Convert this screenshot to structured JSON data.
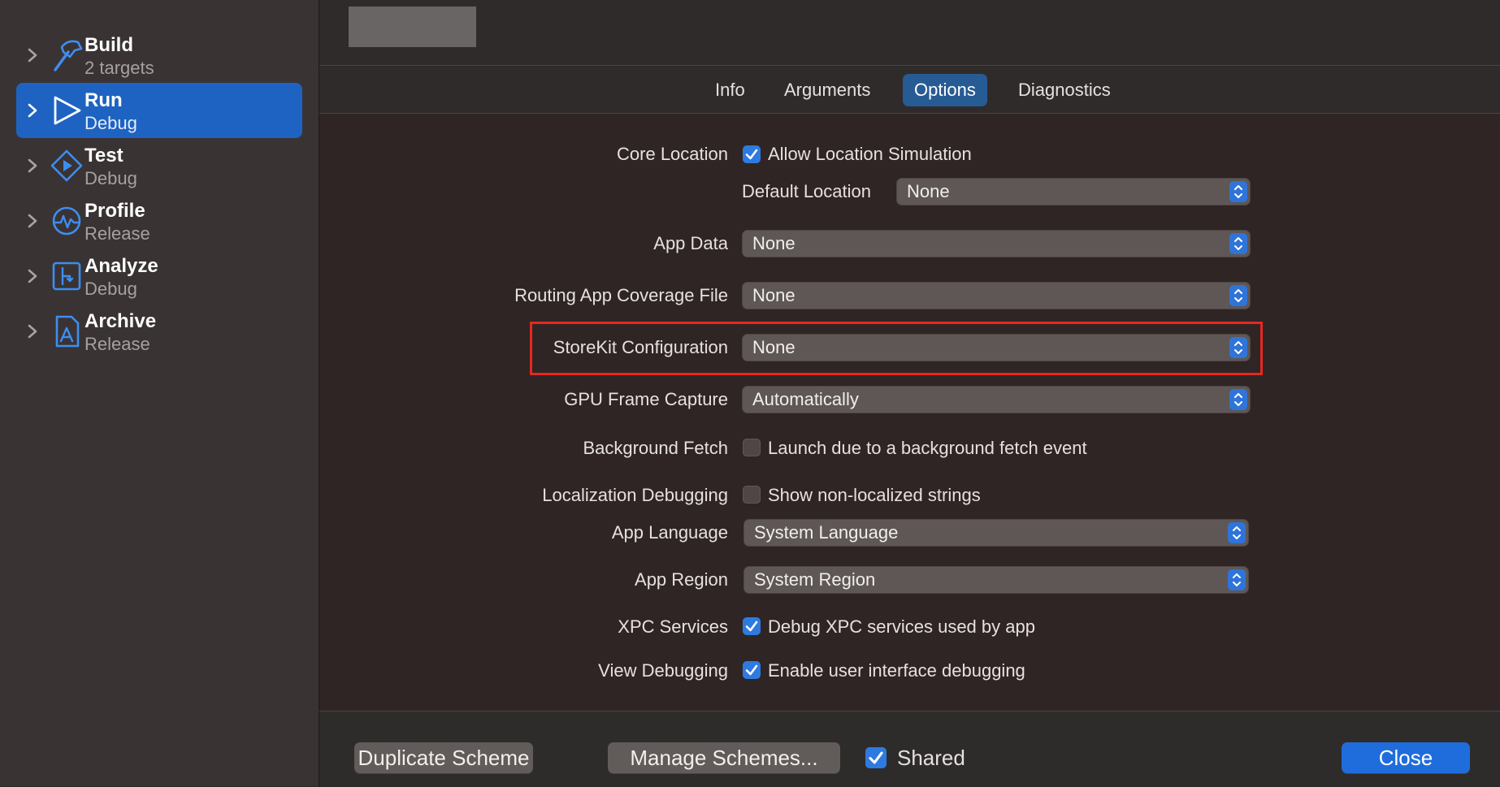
{
  "sidebar": {
    "items": [
      {
        "title": "Build",
        "subtitle": "2 targets",
        "icon": "hammer-icon"
      },
      {
        "title": "Run",
        "subtitle": "Debug",
        "icon": "play-icon",
        "selected": true
      },
      {
        "title": "Test",
        "subtitle": "Debug",
        "icon": "test-diamond-icon"
      },
      {
        "title": "Profile",
        "subtitle": "Release",
        "icon": "instruments-gauge-icon"
      },
      {
        "title": "Analyze",
        "subtitle": "Debug",
        "icon": "analyze-branch-icon"
      },
      {
        "title": "Archive",
        "subtitle": "Release",
        "icon": "archive-appstore-icon"
      }
    ]
  },
  "tabs": [
    "Info",
    "Arguments",
    "Options",
    "Diagnostics"
  ],
  "active_tab": "Options",
  "options": {
    "core_location": {
      "label": "Core Location",
      "checkbox_label": "Allow Location Simulation",
      "checked": true
    },
    "default_location": {
      "label": "Default Location",
      "value": "None"
    },
    "app_data": {
      "label": "App Data",
      "value": "None"
    },
    "routing_app_coverage": {
      "label": "Routing App Coverage File",
      "value": "None"
    },
    "storekit_configuration": {
      "label": "StoreKit Configuration",
      "value": "None",
      "highlighted": true
    },
    "gpu_frame_capture": {
      "label": "GPU Frame Capture",
      "value": "Automatically"
    },
    "background_fetch": {
      "label": "Background Fetch",
      "checkbox_label": "Launch due to a background fetch event",
      "checked": false
    },
    "localization_debugging": {
      "label": "Localization Debugging",
      "checkbox_label": "Show non-localized strings",
      "checked": false
    },
    "app_language": {
      "label": "App Language",
      "value": "System Language"
    },
    "app_region": {
      "label": "App Region",
      "value": "System Region"
    },
    "xpc_services": {
      "label": "XPC Services",
      "checkbox_label": "Debug XPC services used by app",
      "checked": true
    },
    "view_debugging": {
      "label": "View Debugging",
      "checkbox_label": "Enable user interface debugging",
      "checked": true
    }
  },
  "footer": {
    "duplicate_label": "Duplicate Scheme",
    "manage_label": "Manage Schemes...",
    "shared_label": "Shared",
    "shared_checked": true,
    "close_label": "Close"
  },
  "colors": {
    "accent": "#1e63c2",
    "highlight_box": "#e8271f",
    "background": "#2e2524"
  }
}
